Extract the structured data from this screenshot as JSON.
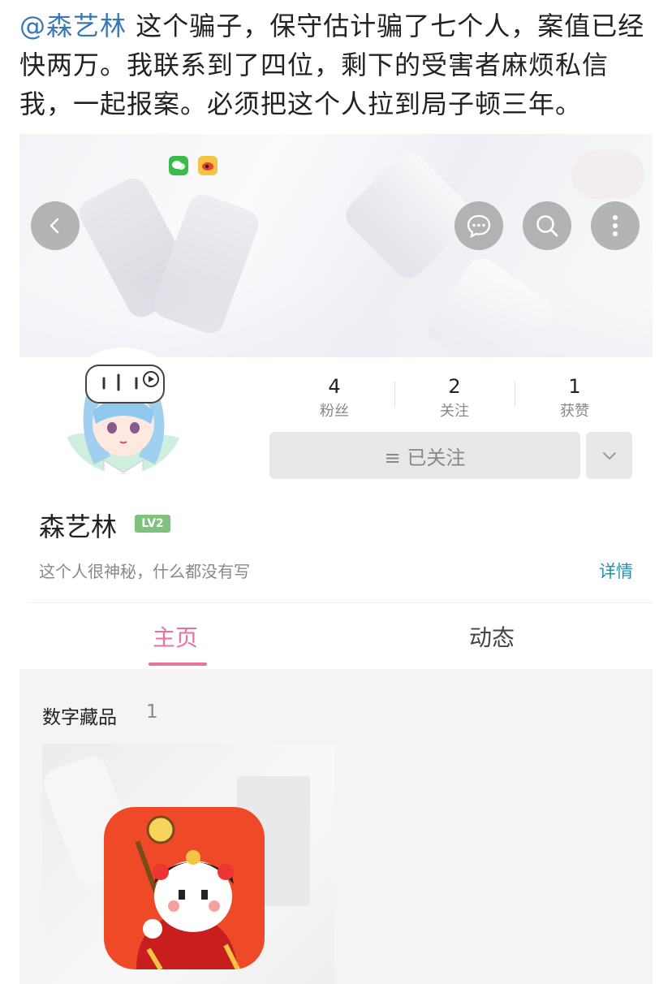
{
  "post": {
    "mention": "@森艺林",
    "text": " 这个骗子，保守估计骗了七个人，案值已经快两万。我联系到了四位，剩下的受害者麻烦私信我，一起报案。必须把这个人拉到局子顿三年。"
  },
  "header": {
    "back_icon": "chevron-left-icon",
    "icons": [
      "chat-icon",
      "search-icon",
      "more-icon"
    ]
  },
  "stats": [
    {
      "value": "4",
      "label": "粉丝"
    },
    {
      "value": "2",
      "label": "关注"
    },
    {
      "value": "1",
      "label": "获赞"
    }
  ],
  "follow": {
    "label": "≡ 已关注"
  },
  "profile": {
    "name": "森艺林",
    "level": "LV2",
    "bio": "这个人很神秘，什么都没有写",
    "detail_link": "详情"
  },
  "tabs": [
    {
      "label": "主页",
      "active": true
    },
    {
      "label": "动态",
      "active": false
    }
  ],
  "collection": {
    "title": "数字藏品",
    "count": "1"
  },
  "colors": {
    "accent": "#e6749c",
    "link": "#3a78b7",
    "detail": "#2b8fb0",
    "level_badge": "#7fc27f"
  }
}
